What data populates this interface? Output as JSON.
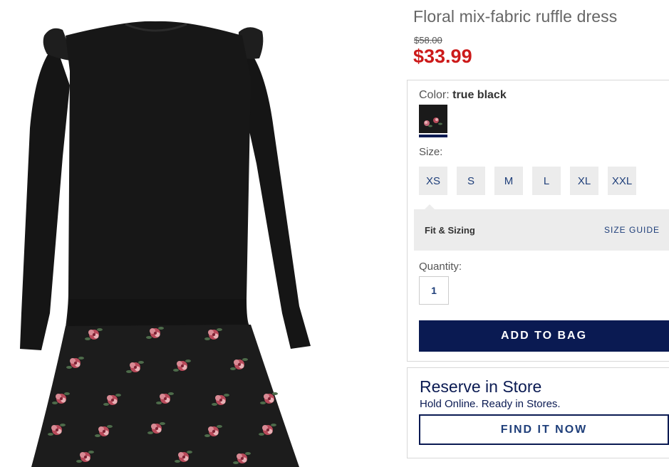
{
  "product": {
    "title": "Floral mix-fabric ruffle dress",
    "price_original": "$58.00",
    "price_sale": "$33.99",
    "image_icon": "dress-photo"
  },
  "color": {
    "label": "Color:",
    "selected": "true black",
    "swatch_color": "#1a1a1a"
  },
  "size": {
    "label": "Size:",
    "options": [
      "XS",
      "S",
      "M",
      "L",
      "XL",
      "XXL"
    ]
  },
  "fit": {
    "label": "Fit & Sizing",
    "guide_link": "SIZE GUIDE"
  },
  "quantity": {
    "label": "Quantity:",
    "value": "1"
  },
  "actions": {
    "add_to_bag": "ADD TO BAG"
  },
  "reserve": {
    "title": "Reserve in Store",
    "subtitle": "Hold Online. Ready in Stores.",
    "find_button": "FIND IT NOW"
  },
  "colors": {
    "accent_navy": "#0a1a52",
    "link_blue": "#1f3f7a",
    "sale_red": "#cc1a1a",
    "panel_gray": "#ececec"
  }
}
